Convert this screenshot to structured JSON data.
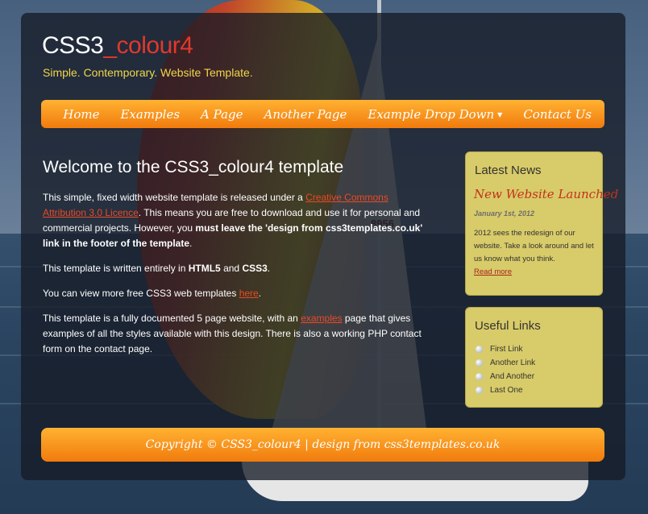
{
  "site": {
    "logo_main": "CSS3",
    "logo_accent": "_colour4",
    "slogan": "Simple. Contemporary. Website Template."
  },
  "menu": {
    "items": [
      {
        "label": "Home"
      },
      {
        "label": "Examples"
      },
      {
        "label": "A Page"
      },
      {
        "label": "Another Page"
      },
      {
        "label": "Example Drop Down"
      },
      {
        "label": "Contact Us"
      }
    ]
  },
  "content": {
    "heading": "Welcome to the CSS3_colour4 template",
    "p1_a": "This simple, fixed width website template is released under a ",
    "p1_link": "Creative Commons Attribution 3.0 Licence",
    "p1_b": ". This means you are free to download and use it for personal and commercial projects. However, you ",
    "p1_bold": "must leave the 'design from css3templates.co.uk' link in the footer of the template",
    "p1_c": ".",
    "p2_a": "This template is written entirely in ",
    "p2_b1": "HTML5",
    "p2_and": " and ",
    "p2_b2": "CSS3",
    "p2_end": ".",
    "p3_a": "You can view more free CSS3 web templates ",
    "p3_link": "here",
    "p3_end": ".",
    "p4_a": "This template is a fully documented 5 page website, with an ",
    "p4_link": "examples",
    "p4_b": " page that gives examples of all the styles available with this design. There is also a working PHP contact form on the contact page."
  },
  "news": {
    "heading": "Latest News",
    "title": "New Website Launched",
    "date": "January 1st, 2012",
    "text": "2012 sees the redesign of our website. Take a look around and let us know what you think.",
    "more": "Read more"
  },
  "links": {
    "heading": "Useful Links",
    "items": [
      "First Link",
      "Another Link",
      "And Another",
      "Last One"
    ]
  },
  "footer": {
    "text": "Copyright © CSS3_colour4 | design from css3templates.co.uk"
  },
  "background": {
    "hull_number": "8956"
  },
  "colors": {
    "accent_orange": "#f7931e",
    "logo_red": "#e3382a",
    "slogan_yellow": "#f0d64a",
    "sidebar_yellow": "#d8cb69",
    "link_red": "#ea4a25"
  }
}
